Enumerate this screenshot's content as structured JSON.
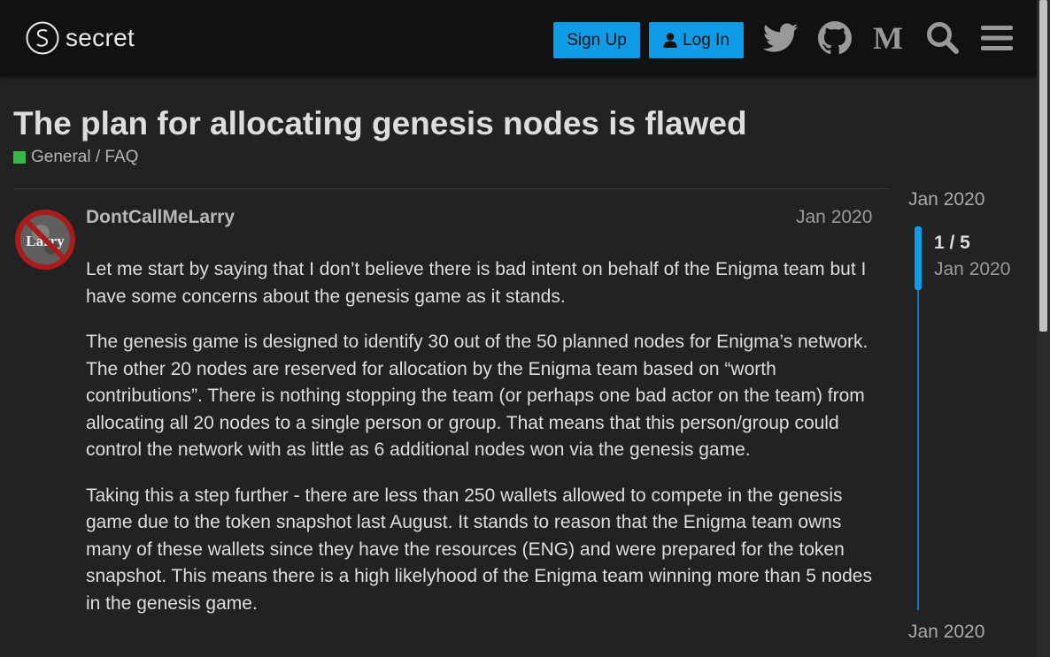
{
  "header": {
    "logo_text": "secret",
    "signup_label": "Sign Up",
    "login_label": "Log In",
    "icons": [
      "twitter-icon",
      "github-icon",
      "medium-icon",
      "search-icon",
      "hamburger-menu-icon"
    ]
  },
  "topic": {
    "title": "The plan for allocating genesis nodes is flawed",
    "category": "General / FAQ",
    "category_color": "#3ab54a"
  },
  "post": {
    "avatar_text": "Larry",
    "username": "DontCallMeLarry",
    "date": "Jan 2020",
    "paragraphs": [
      "Let me start by saying that I don’t believe there is bad intent on behalf of the Enigma team but I have some concerns about the genesis game as it stands.",
      "The genesis game is designed to identify 30 out of the 50 planned nodes for Enigma’s network. The other 20 nodes are reserved for allocation by the Enigma team based on “worth contributions”. There is nothing stopping the team (or perhaps one bad actor on the team) from allocating all 20 nodes to a single person or group. That means that this person/group could control the network with as little as 6 additional nodes won via the genesis game.",
      "Taking this a step further - there are less than 250 wallets allowed to compete in the genesis game due to the token snapshot last August. It stands to reason that the Enigma team owns many of these wallets since they have the resources (ENG) and were prepared for the token snapshot. This means there is a high likelyhood of the Enigma team winning more than 5 nodes in the genesis game."
    ]
  },
  "timeline": {
    "start_date": "Jan 2020",
    "position": "1 / 5",
    "position_date": "Jan 2020",
    "end_date": "Jan 2020"
  },
  "colors": {
    "accent": "#0e9ce7",
    "header_bg": "#111111",
    "page_bg": "#222222"
  }
}
